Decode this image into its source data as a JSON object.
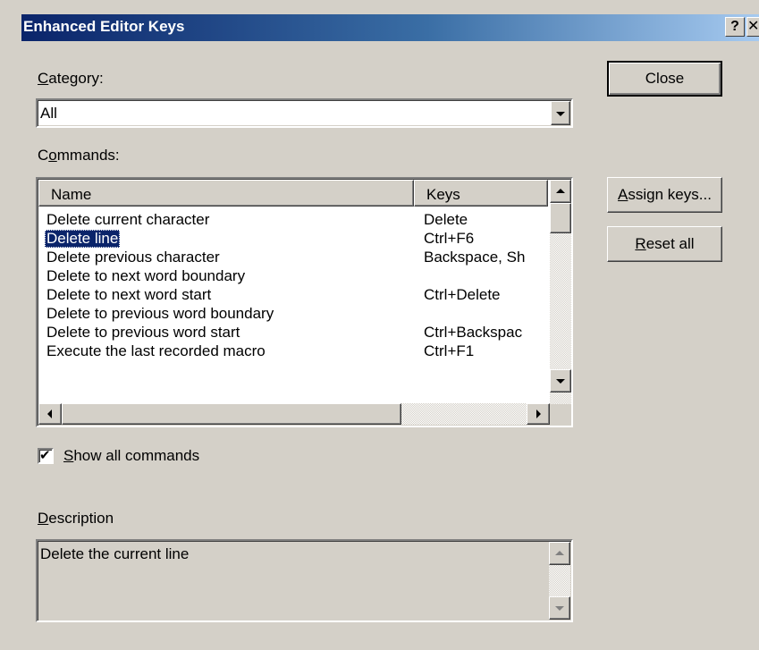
{
  "window": {
    "title": "Enhanced Editor Keys",
    "help_glyph": "?",
    "close_glyph": "✕"
  },
  "category": {
    "label_accel": "C",
    "label_rest": "ategory:",
    "value": "All"
  },
  "commands": {
    "label_first": "C",
    "label_accel": "o",
    "label_rest": "mmands:",
    "columns": {
      "name": "Name",
      "keys": "Keys"
    },
    "rows": [
      {
        "name": "Delete current character",
        "keys": "Delete"
      },
      {
        "name": "Delete line",
        "keys": "Ctrl+F6",
        "selected": true
      },
      {
        "name": "Delete previous character",
        "keys": "Backspace, Sh"
      },
      {
        "name": "Delete to next word boundary",
        "keys": ""
      },
      {
        "name": "Delete to next word start",
        "keys": "Ctrl+Delete"
      },
      {
        "name": "Delete to previous word boundary",
        "keys": ""
      },
      {
        "name": "Delete to previous word start",
        "keys": "Ctrl+Backspac"
      },
      {
        "name": "Execute the last recorded macro",
        "keys": "Ctrl+F1"
      }
    ]
  },
  "show_all": {
    "label_accel": "S",
    "label_rest": "how all commands",
    "checked": true,
    "check_glyph": "✔"
  },
  "description": {
    "label_accel": "D",
    "label_rest": "escription",
    "text": "Delete the current line"
  },
  "buttons": {
    "close": "Close",
    "assign_accel": "A",
    "assign_rest": "ssign keys...",
    "reset_accel": "R",
    "reset_rest": "eset all"
  },
  "colors": {
    "face": "#d4d0c8",
    "title_active": "#0a246a",
    "selection": "#0a246a"
  },
  "icons": [
    "help-icon",
    "close-icon",
    "dropdown-arrow-icon",
    "scroll-up-icon",
    "scroll-down-icon",
    "scroll-left-icon",
    "scroll-right-icon",
    "checkmark-icon"
  ]
}
